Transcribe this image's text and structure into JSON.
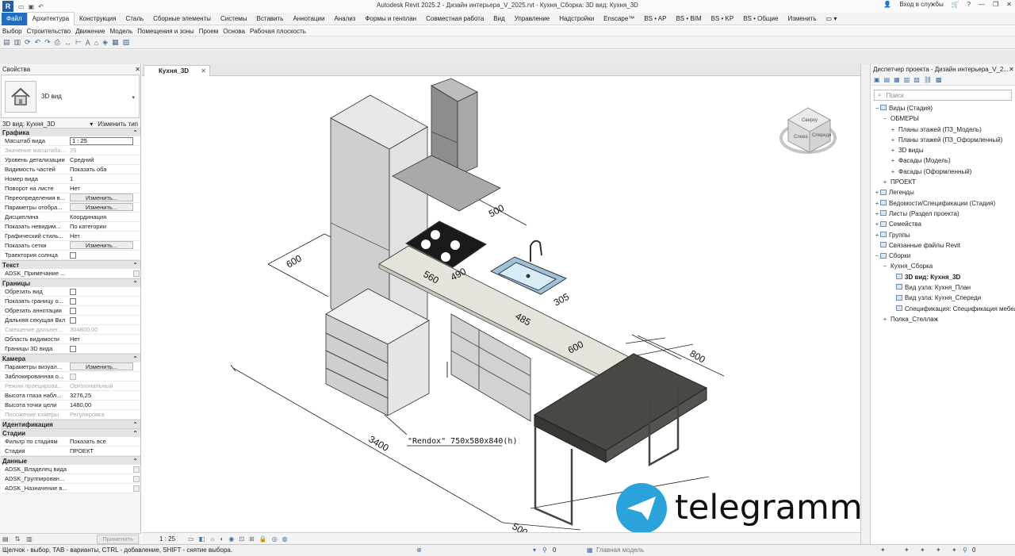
{
  "app": {
    "title": "Autodesk Revit 2025.2 - Дизайн интерьера_V_2025.rvt - Кухня_Сборка: 3D вид: Кухня_3D",
    "logo": "R",
    "signin": "Вход в службы"
  },
  "ribbon_tabs": [
    "Файл",
    "Архитектура",
    "Конструкция",
    "Сталь",
    "Сборные элементы",
    "Системы",
    "Вставить",
    "Аннотации",
    "Анализ",
    "Формы и генплан",
    "Совместная работа",
    "Вид",
    "Управление",
    "Надстройки",
    "Enscape™",
    "BS • AP",
    "BS • BIM",
    "BS • KP",
    "BS • Общие",
    "Изменить"
  ],
  "select_bar": [
    "Выбор",
    "Строительство",
    "Движение",
    "Модель",
    "Помещения и зоны",
    "Проем",
    "Основа",
    "Рабочая плоскость"
  ],
  "properties": {
    "title": "Свойства",
    "type_name": "3D вид",
    "instance": "3D вид: Кухня_3D",
    "edit_type": "Изменить тип",
    "sections": [
      {
        "name": "Графика",
        "rows": [
          {
            "k": "Масштаб вида",
            "v": "1 : 25",
            "kind": "input"
          },
          {
            "k": "Значение масштаба...",
            "v": "25",
            "kind": "dis"
          },
          {
            "k": "Уровень детализации",
            "v": "Средний"
          },
          {
            "k": "Видимость частей",
            "v": "Показать оба"
          },
          {
            "k": "Номер вида",
            "v": "1"
          },
          {
            "k": "Поворот на листе",
            "v": "Нет"
          },
          {
            "k": "Переопределения в...",
            "v": "Изменить...",
            "kind": "btn"
          },
          {
            "k": "Параметры отобра...",
            "v": "Изменить...",
            "kind": "btn"
          },
          {
            "k": "Дисциплина",
            "v": "Координация"
          },
          {
            "k": "Показать невидим...",
            "v": "По категории"
          },
          {
            "k": "Графический стиль...",
            "v": "Нет"
          },
          {
            "k": "Показать сетки",
            "v": "Изменить...",
            "kind": "btn"
          },
          {
            "k": "Траектория солнца",
            "v": "",
            "kind": "cb"
          }
        ]
      },
      {
        "name": "Текст",
        "rows": [
          {
            "k": "ADSK_Примечание ...",
            "v": "",
            "kind": "cbr"
          }
        ]
      },
      {
        "name": "Границы",
        "rows": [
          {
            "k": "Обрезать вид",
            "v": "",
            "kind": "cb"
          },
          {
            "k": "Показать границу о...",
            "v": "",
            "kind": "cb"
          },
          {
            "k": "Обрезать аннотации",
            "v": "",
            "kind": "cb"
          },
          {
            "k": "Дальняя секущая Вкл",
            "v": "",
            "kind": "cb"
          },
          {
            "k": "Смещение дальнег...",
            "v": "304800,00",
            "kind": "dis"
          },
          {
            "k": "Область видимости",
            "v": "Нет"
          },
          {
            "k": "Границы 3D вида",
            "v": "",
            "kind": "cb"
          }
        ]
      },
      {
        "name": "Камера",
        "rows": [
          {
            "k": "Параметры визуал...",
            "v": "Изменить...",
            "kind": "btn"
          },
          {
            "k": "Заблокированная о...",
            "v": "",
            "kind": "cbd"
          },
          {
            "k": "Режим проецирова...",
            "v": "Ортогональный",
            "kind": "dis"
          },
          {
            "k": "Высота глаза набл...",
            "v": "3276,25"
          },
          {
            "k": "Высота точки цели",
            "v": "1480,00"
          },
          {
            "k": "Положение камеры",
            "v": "Регулировка",
            "kind": "dis"
          }
        ]
      },
      {
        "name": "Идентификация",
        "rows": []
      },
      {
        "name": "Стадии",
        "rows": [
          {
            "k": "Фильтр по стадиям",
            "v": "Показать все"
          },
          {
            "k": "Стадия",
            "v": "ПРОЕКТ"
          }
        ]
      },
      {
        "name": "Данные",
        "rows": [
          {
            "k": "ADSK_Владелец вида",
            "v": "",
            "kind": "cbr"
          },
          {
            "k": "ADSK_Группирован...",
            "v": "",
            "kind": "cbr"
          },
          {
            "k": "ADSK_Назначение в...",
            "v": "",
            "kind": "cbr"
          }
        ]
      }
    ],
    "apply": "Применить"
  },
  "view": {
    "tab": "Кухня_3D",
    "scale": "1 : 25",
    "cube_faces": [
      "Слева",
      "Спереди",
      "Сверху"
    ],
    "dims": [
      "600",
      "500",
      "560",
      "490",
      "305",
      "485",
      "600",
      "800",
      "3400",
      "500"
    ],
    "tag": "\"Rendox\" 750x580x840(h)",
    "watermark": "telegrammy.net",
    "colors": {
      "counter": "#e6e3dc",
      "cabinet": "#d4d4d4",
      "dark_top": "#4a4843",
      "sink": "#9fc3d6",
      "hood": "#8d8d8d"
    }
  },
  "browser": {
    "title": "Диспетчер проекта - Дизайн интерьера_V_2...",
    "search": "Поиск",
    "nodes": [
      {
        "l": 0,
        "t": "-",
        "ic": true,
        "label": "Виды (Стадия)"
      },
      {
        "l": 1,
        "t": "-",
        "ic": false,
        "label": "ОБМЕРЫ"
      },
      {
        "l": 2,
        "t": "+",
        "ic": false,
        "label": "Планы этажей (ПЗ_Модель)"
      },
      {
        "l": 2,
        "t": "+",
        "ic": false,
        "label": "Планы этажей (ПЗ_Оформленный)"
      },
      {
        "l": 2,
        "t": "+",
        "ic": false,
        "label": "3D виды"
      },
      {
        "l": 2,
        "t": "+",
        "ic": false,
        "label": "Фасады (Модель)"
      },
      {
        "l": 2,
        "t": "+",
        "ic": false,
        "label": "Фасады (Оформленный)"
      },
      {
        "l": 1,
        "t": "+",
        "ic": false,
        "label": "ПРОЕКТ"
      },
      {
        "l": 0,
        "t": "+",
        "ic": true,
        "label": "Легенды"
      },
      {
        "l": 0,
        "t": "+",
        "ic": true,
        "label": "Ведомости/Спецификации (Стадия)"
      },
      {
        "l": 0,
        "t": "+",
        "ic": true,
        "label": "Листы (Раздел проекта)"
      },
      {
        "l": 0,
        "t": "+",
        "ic": true,
        "label": "Семейства"
      },
      {
        "l": 0,
        "t": "+",
        "ic": true,
        "label": "Группы"
      },
      {
        "l": 0,
        "t": "",
        "ic": true,
        "label": "Связанные файлы Revit"
      },
      {
        "l": 0,
        "t": "-",
        "ic": true,
        "label": "Сборки"
      },
      {
        "l": 1,
        "t": "-",
        "ic": false,
        "label": "Кухня_Сборка"
      },
      {
        "l": 2,
        "t": "",
        "ic": true,
        "label": "3D вид: Кухня_3D",
        "bold": true
      },
      {
        "l": 2,
        "t": "",
        "ic": true,
        "label": "Вид узла: Кухня_План"
      },
      {
        "l": 2,
        "t": "",
        "ic": true,
        "label": "Вид узла: Кухня_Спереди"
      },
      {
        "l": 2,
        "t": "",
        "ic": true,
        "label": "Спецификация: Спецификация мебели"
      },
      {
        "l": 1,
        "t": "+",
        "ic": false,
        "label": "Полка_Стеллаж"
      }
    ]
  },
  "status": {
    "text": "Щелчок - выбор, TAB - варианты, CTRL - добавление, SHIFT - снятие выбора.",
    "model": "Главная модель",
    "zero1": "0",
    "zero2": "0"
  }
}
